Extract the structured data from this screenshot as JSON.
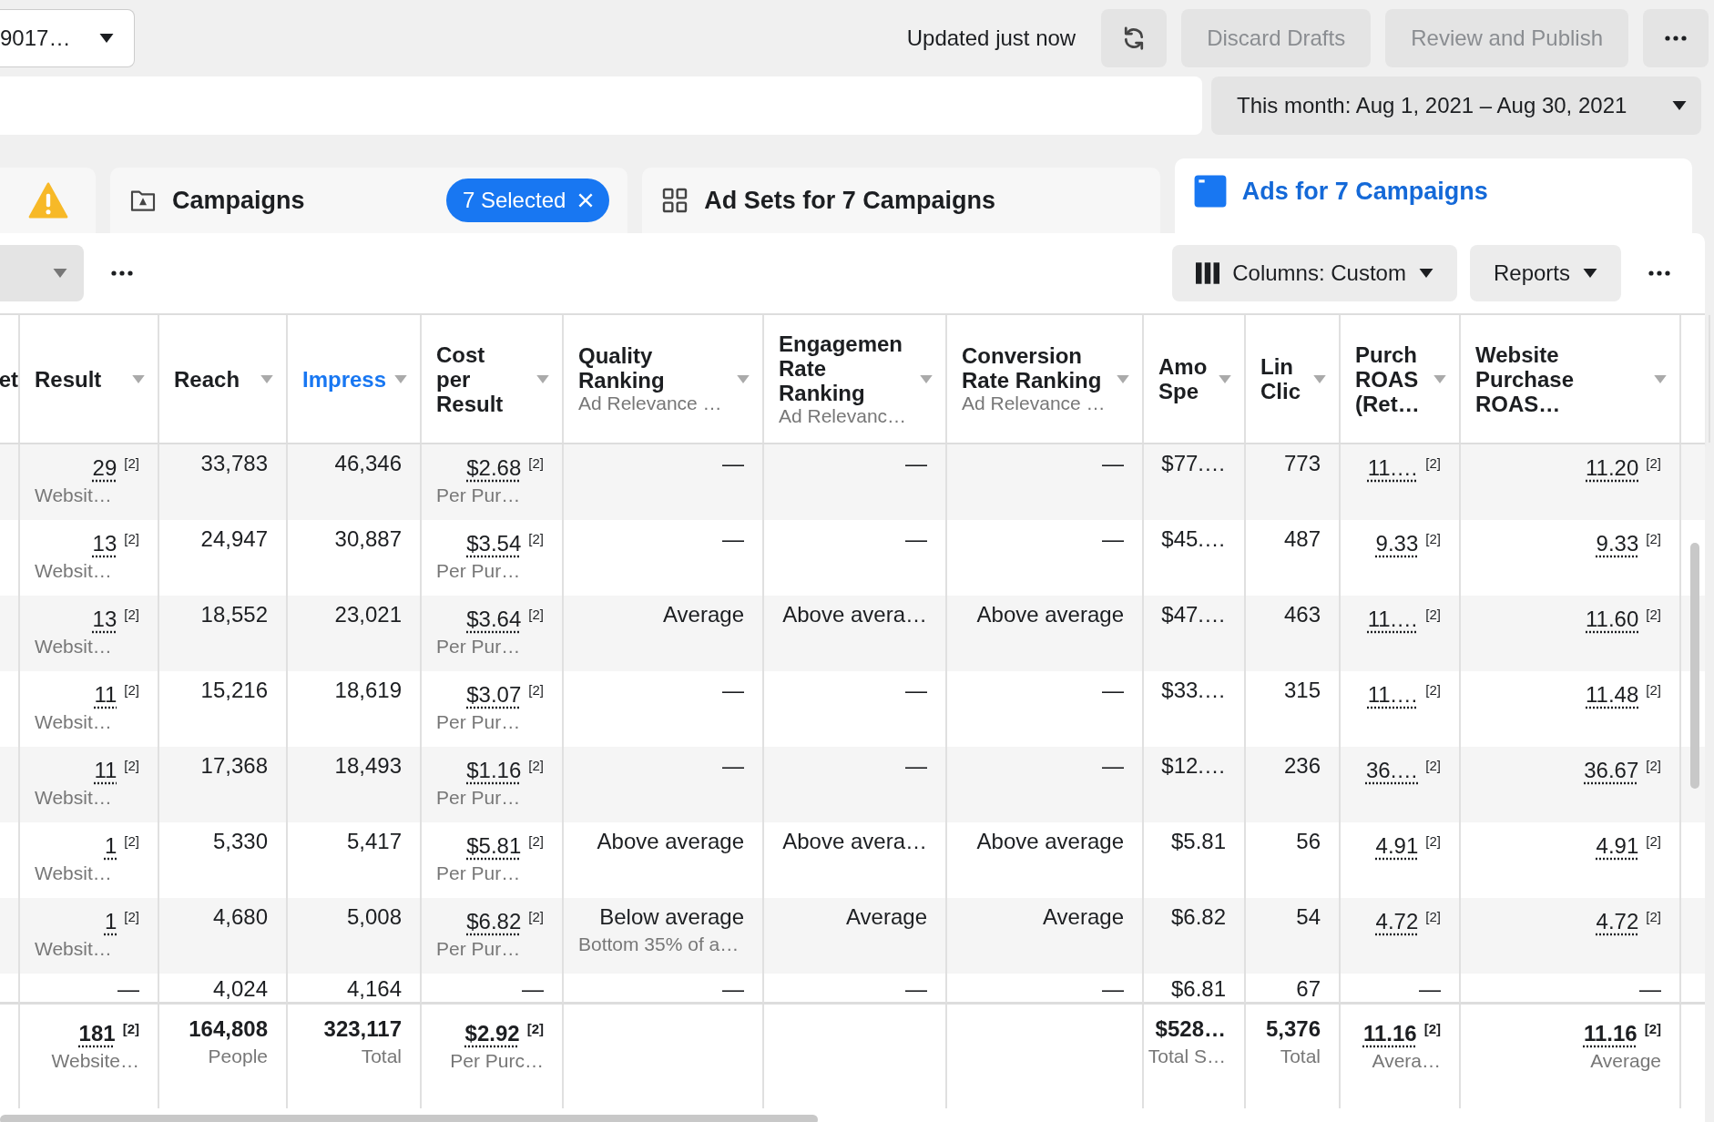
{
  "top_bar": {
    "account": "9017…",
    "status": "Updated just now",
    "buttons": [
      {
        "label": "Discard Drafts",
        "disabled": true
      },
      {
        "label": "Review and Publish",
        "disabled": true
      }
    ]
  },
  "date_range": {
    "label": "This month: Aug 1, 2021 – Aug 30, 2021"
  },
  "tabs": [
    {
      "kind": "warning",
      "selected": false
    },
    {
      "kind": "campaigns",
      "label": "Campaigns",
      "chip": "7 Selected",
      "selected": false
    },
    {
      "kind": "adsets",
      "label": "Ad Sets for 7 Campaigns",
      "selected": false
    },
    {
      "kind": "ads",
      "label": "Ads for 7 Campaigns",
      "selected": true
    }
  ],
  "toolbar": {
    "columns": "Columns: Custom",
    "reports": "Reports"
  },
  "table": {
    "cut_column_header": "et",
    "columns": [
      {
        "lines": [
          "Result"
        ],
        "sortable": true,
        "selected": false
      },
      {
        "lines": [
          "Reach"
        ],
        "sortable": true,
        "selected": false
      },
      {
        "lines": [
          "Impress"
        ],
        "sortable": true,
        "selected": true
      },
      {
        "lines": [
          "Cost",
          "per",
          "Result"
        ],
        "sortable": true,
        "selected": false
      },
      {
        "lines": [
          "Quality",
          "Ranking"
        ],
        "sub": "Ad Relevance …",
        "sortable": true,
        "selected": false
      },
      {
        "lines": [
          "Engagemen",
          "Rate",
          "Ranking"
        ],
        "sub": "Ad Relevanc…",
        "sortable": true,
        "selected": false
      },
      {
        "lines": [
          "Conversion",
          "Rate Ranking"
        ],
        "sub": "Ad Relevance …",
        "sortable": true,
        "selected": false
      },
      {
        "lines": [
          "Amo",
          "Spe"
        ],
        "sortable": true,
        "selected": false
      },
      {
        "lines": [
          "Lin",
          "Clic"
        ],
        "sortable": true,
        "selected": false
      },
      {
        "lines": [
          "Purch",
          "ROAS",
          "(Ret…"
        ],
        "sortable": true,
        "selected": false
      },
      {
        "lines": [
          "Website",
          "Purchase",
          "ROAS…"
        ],
        "sortable": true,
        "selected": false
      }
    ],
    "rows": [
      {
        "cells": [
          {
            "value": "29",
            "note": "[2]",
            "sub": "Websit…"
          },
          {
            "value": "33,783"
          },
          {
            "value": "46,346"
          },
          {
            "value": "$2.68",
            "note": "[2]",
            "sub": "Per Pur…"
          },
          {
            "value": "—"
          },
          {
            "value": "—"
          },
          {
            "value": "—"
          },
          {
            "value": "$77.…"
          },
          {
            "value": "773"
          },
          {
            "value": "11.…",
            "note": "[2]"
          },
          {
            "value": "11.20",
            "note": "[2]"
          }
        ]
      },
      {
        "cells": [
          {
            "value": "13",
            "note": "[2]",
            "sub": "Websit…"
          },
          {
            "value": "24,947"
          },
          {
            "value": "30,887"
          },
          {
            "value": "$3.54",
            "note": "[2]",
            "sub": "Per Pur…"
          },
          {
            "value": "—"
          },
          {
            "value": "—"
          },
          {
            "value": "—"
          },
          {
            "value": "$45.…"
          },
          {
            "value": "487"
          },
          {
            "value": "9.33",
            "note": "[2]"
          },
          {
            "value": "9.33",
            "note": "[2]"
          }
        ]
      },
      {
        "cells": [
          {
            "value": "13",
            "note": "[2]",
            "sub": "Websit…"
          },
          {
            "value": "18,552"
          },
          {
            "value": "23,021"
          },
          {
            "value": "$3.64",
            "note": "[2]",
            "sub": "Per Pur…"
          },
          {
            "value": "Average"
          },
          {
            "value": "Above avera…"
          },
          {
            "value": "Above average"
          },
          {
            "value": "$47.…"
          },
          {
            "value": "463"
          },
          {
            "value": "11.…",
            "note": "[2]"
          },
          {
            "value": "11.60",
            "note": "[2]"
          }
        ]
      },
      {
        "cells": [
          {
            "value": "11",
            "note": "[2]",
            "sub": "Websit…"
          },
          {
            "value": "15,216"
          },
          {
            "value": "18,619"
          },
          {
            "value": "$3.07",
            "note": "[2]",
            "sub": "Per Pur…"
          },
          {
            "value": "—"
          },
          {
            "value": "—"
          },
          {
            "value": "—"
          },
          {
            "value": "$33.…"
          },
          {
            "value": "315"
          },
          {
            "value": "11.…",
            "note": "[2]"
          },
          {
            "value": "11.48",
            "note": "[2]"
          }
        ]
      },
      {
        "cells": [
          {
            "value": "11",
            "note": "[2]",
            "sub": "Websit…"
          },
          {
            "value": "17,368"
          },
          {
            "value": "18,493"
          },
          {
            "value": "$1.16",
            "note": "[2]",
            "sub": "Per Pur…"
          },
          {
            "value": "—"
          },
          {
            "value": "—"
          },
          {
            "value": "—"
          },
          {
            "value": "$12.…"
          },
          {
            "value": "236"
          },
          {
            "value": "36.…",
            "note": "[2]"
          },
          {
            "value": "36.67",
            "note": "[2]"
          }
        ]
      },
      {
        "cells": [
          {
            "value": "1",
            "note": "[2]",
            "sub": "Websit…"
          },
          {
            "value": "5,330"
          },
          {
            "value": "5,417"
          },
          {
            "value": "$5.81",
            "note": "[2]",
            "sub": "Per Pur…"
          },
          {
            "value": "Above average"
          },
          {
            "value": "Above avera…"
          },
          {
            "value": "Above average"
          },
          {
            "value": "$5.81"
          },
          {
            "value": "56"
          },
          {
            "value": "4.91",
            "note": "[2]"
          },
          {
            "value": "4.91",
            "note": "[2]"
          }
        ]
      },
      {
        "cells": [
          {
            "value": "1",
            "note": "[2]",
            "sub": "Websit…"
          },
          {
            "value": "4,680"
          },
          {
            "value": "5,008"
          },
          {
            "value": "$6.82",
            "note": "[2]",
            "sub": "Per Pur…"
          },
          {
            "value": "Below average",
            "sub": "Bottom 35% of a…"
          },
          {
            "value": "Average"
          },
          {
            "value": "Average"
          },
          {
            "value": "$6.82"
          },
          {
            "value": "54"
          },
          {
            "value": "4.72",
            "note": "[2]"
          },
          {
            "value": "4.72",
            "note": "[2]"
          }
        ]
      },
      {
        "cells": [
          {
            "value": "—"
          },
          {
            "value": "4,024"
          },
          {
            "value": "4,164"
          },
          {
            "value": "—"
          },
          {
            "value": "—"
          },
          {
            "value": "—"
          },
          {
            "value": "—"
          },
          {
            "value": "$6.81"
          },
          {
            "value": "67"
          },
          {
            "value": "—"
          },
          {
            "value": "—"
          }
        ]
      }
    ],
    "totals": {
      "left": [
        {
          "value": "181",
          "note": "[2]",
          "sub": "Website…"
        },
        {
          "value": "164,808",
          "sub": "People"
        },
        {
          "value": "323,117",
          "sub": "Total"
        },
        {
          "value": "$2.92",
          "note": "[2]",
          "sub": "Per Purc…"
        }
      ],
      "right": [
        {
          "value": "$528…",
          "sub": "Total S…"
        },
        {
          "value": "5,376",
          "sub": "Total"
        },
        {
          "value": "11.16",
          "note": "[2]",
          "sub": "Avera…"
        },
        {
          "value": "11.16",
          "note": "[2]",
          "sub": "Average"
        }
      ]
    }
  }
}
